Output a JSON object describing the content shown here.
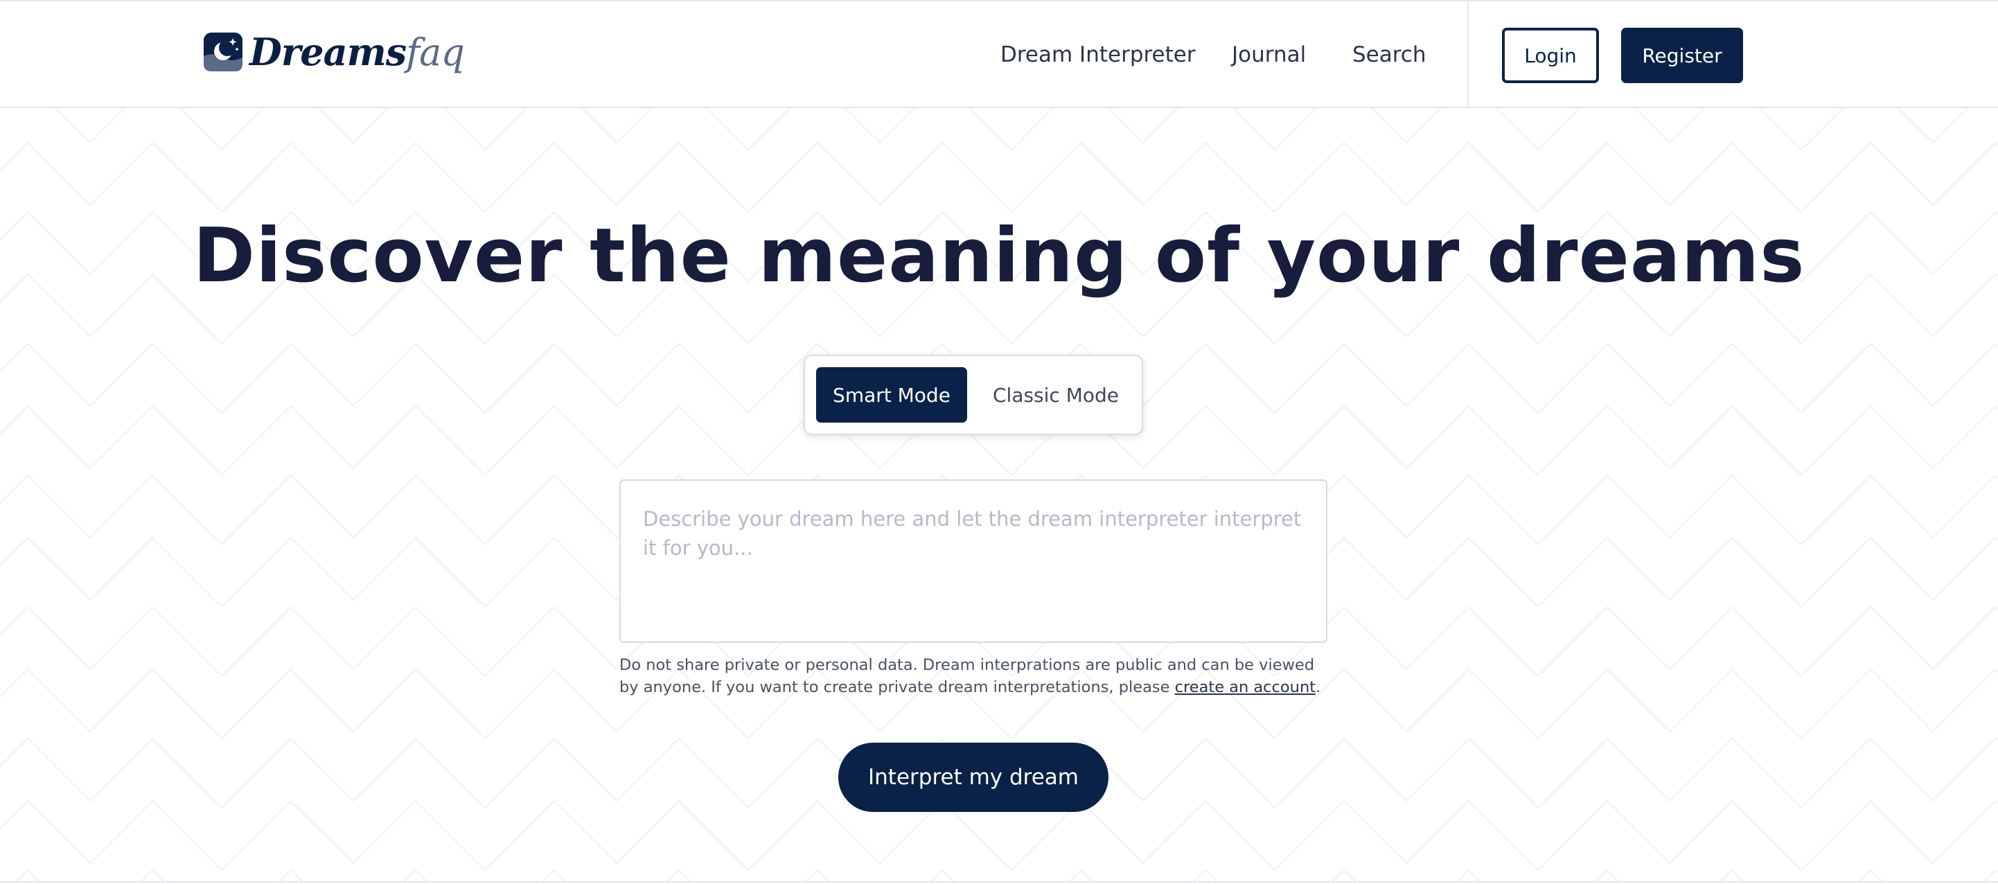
{
  "header": {
    "logo_text_main": "Dreams",
    "logo_text_accent": "faq",
    "nav": [
      {
        "label": "Dream Interpreter"
      },
      {
        "label": "Journal"
      },
      {
        "label": "Search"
      }
    ],
    "login_label": "Login",
    "register_label": "Register"
  },
  "hero": {
    "title": "Discover the meaning of your dreams"
  },
  "mode_toggle": {
    "smart_label": "Smart Mode",
    "classic_label": "Classic Mode",
    "selected": "Smart Mode"
  },
  "dream_form": {
    "placeholder": "Describe your dream here and let the dream interpreter interpret it for you...",
    "value": "",
    "disclaimer_text": "Do not share private or personal data. Dream interprations are public and can be viewed by anyone. If you want to create private dream interpretations, please ",
    "disclaimer_link": "create an account",
    "disclaimer_end": ".",
    "submit_label": "Interpret my dream"
  },
  "colors": {
    "brand_navy": "#0a2247",
    "heading": "#171d3a",
    "placeholder": "#b6b9c7",
    "border": "#d7d9e6"
  },
  "icons": {
    "logo": "moon-stars-icon"
  }
}
